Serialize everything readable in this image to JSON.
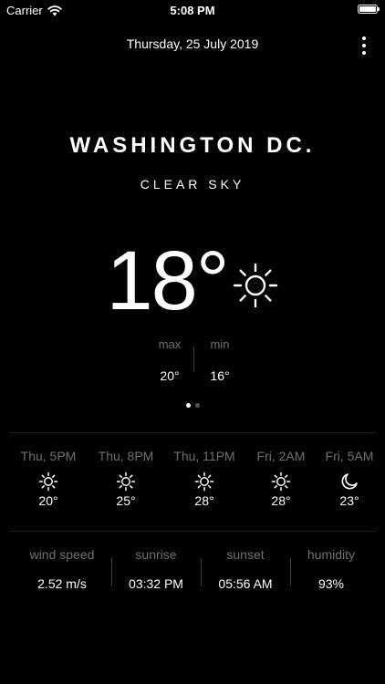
{
  "status_bar": {
    "carrier": "Carrier",
    "time": "5:08 PM",
    "battery_level": 1.0
  },
  "header": {
    "date": "Thursday, 25 July 2019",
    "menu_icon": "more-vertical-icon"
  },
  "current": {
    "city": "WASHINGTON DC.",
    "condition": "CLEAR SKY",
    "temperature": "18°",
    "icon": "sun-icon",
    "max_label": "max",
    "max_value": "20°",
    "min_label": "min",
    "min_value": "16°"
  },
  "pagination": {
    "count": 2,
    "active_index": 0
  },
  "forecast": [
    {
      "time": "Thu, 5PM",
      "icon": "sun-icon",
      "temp": "20°"
    },
    {
      "time": "Thu, 8PM",
      "icon": "sun-icon",
      "temp": "25°"
    },
    {
      "time": "Thu, 11PM",
      "icon": "sun-icon",
      "temp": "28°"
    },
    {
      "time": "Fri, 2AM",
      "icon": "sun-icon",
      "temp": "28°"
    },
    {
      "time": "Fri, 5AM",
      "icon": "moon-icon",
      "temp": "23°"
    }
  ],
  "details": [
    {
      "label": "wind speed",
      "value": "2.52 m/s"
    },
    {
      "label": "sunrise",
      "value": "03:32 PM"
    },
    {
      "label": "sunset",
      "value": "05:56 AM"
    },
    {
      "label": "humidity",
      "value": "93%"
    }
  ],
  "colors": {
    "background": "#000000",
    "text": "#ffffff",
    "muted_text": "#6f6f6f",
    "divider": "#3a3a3a"
  }
}
